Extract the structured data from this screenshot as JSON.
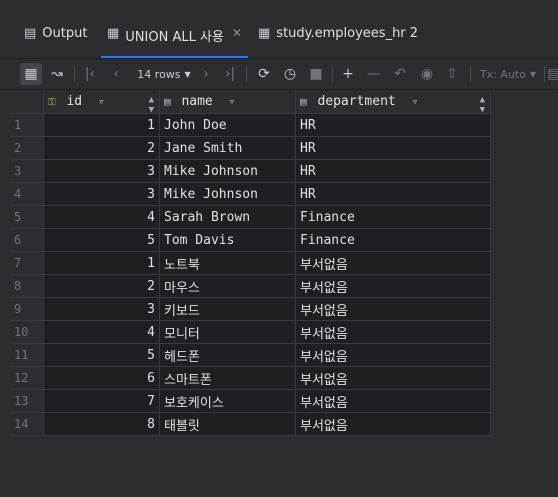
{
  "tabs": [
    {
      "icon": "console-icon",
      "label": "Output",
      "active": false
    },
    {
      "icon": "table-icon",
      "label": "UNION ALL 사용",
      "active": true,
      "closable": true
    },
    {
      "icon": "table-icon",
      "label": "study.employees_hr 2",
      "active": false
    }
  ],
  "toolbar": {
    "rows_label": "14 rows",
    "tx_label": "Tx: Auto"
  },
  "columns": [
    {
      "label": "id"
    },
    {
      "label": "name"
    },
    {
      "label": "department"
    }
  ],
  "rows": [
    {
      "n": "1",
      "id": "1",
      "name": "John Doe",
      "department": "HR"
    },
    {
      "n": "2",
      "id": "2",
      "name": "Jane Smith",
      "department": "HR"
    },
    {
      "n": "3",
      "id": "3",
      "name": "Mike Johnson",
      "department": "HR"
    },
    {
      "n": "4",
      "id": "3",
      "name": "Mike Johnson",
      "department": "HR"
    },
    {
      "n": "5",
      "id": "4",
      "name": "Sarah Brown",
      "department": "Finance"
    },
    {
      "n": "6",
      "id": "5",
      "name": "Tom Davis",
      "department": "Finance"
    },
    {
      "n": "7",
      "id": "1",
      "name": "노트북",
      "department": "부서없음"
    },
    {
      "n": "8",
      "id": "2",
      "name": "마우스",
      "department": "부서없음"
    },
    {
      "n": "9",
      "id": "3",
      "name": "키보드",
      "department": "부서없음"
    },
    {
      "n": "10",
      "id": "4",
      "name": "모니터",
      "department": "부서없음"
    },
    {
      "n": "11",
      "id": "5",
      "name": "헤드폰",
      "department": "부서없음"
    },
    {
      "n": "12",
      "id": "6",
      "name": "스마트폰",
      "department": "부서없음"
    },
    {
      "n": "13",
      "id": "7",
      "name": "보호케이스",
      "department": "부서없음"
    },
    {
      "n": "14",
      "id": "8",
      "name": "태블릿",
      "department": "부서없음"
    }
  ]
}
